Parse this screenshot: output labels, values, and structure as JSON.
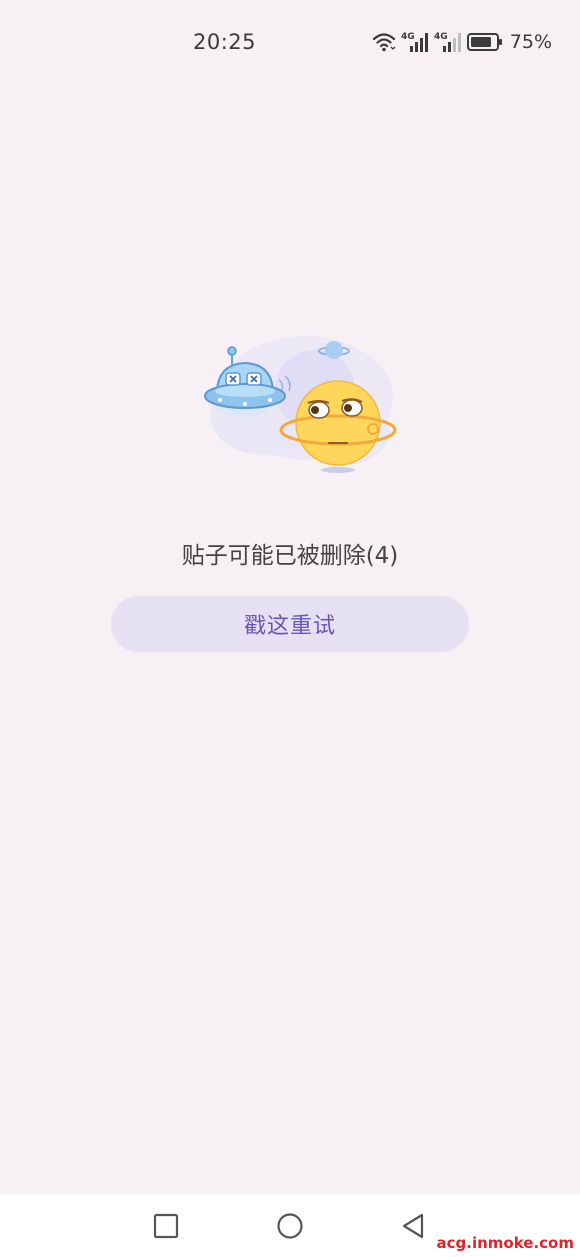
{
  "status_bar": {
    "time": "20:25",
    "network_label_1": "4G",
    "network_label_2": "4G",
    "battery_percent": "75%",
    "icons": [
      "wifi-icon",
      "signal-icon",
      "signal-icon",
      "battery-icon"
    ]
  },
  "main": {
    "illustration_icon": "ufo-and-planet-illustration",
    "message": "贴子可能已被删除(4)",
    "retry_label": "戳这重试"
  },
  "nav_bar": {
    "icons": [
      "recent-apps-icon",
      "home-icon",
      "back-icon"
    ]
  },
  "watermark": "acg.inmoke.com",
  "colors": {
    "background": "#f7f0f5",
    "button_bg": "#e6e1f2",
    "button_text": "#6a58b0",
    "watermark": "#e0222a"
  }
}
